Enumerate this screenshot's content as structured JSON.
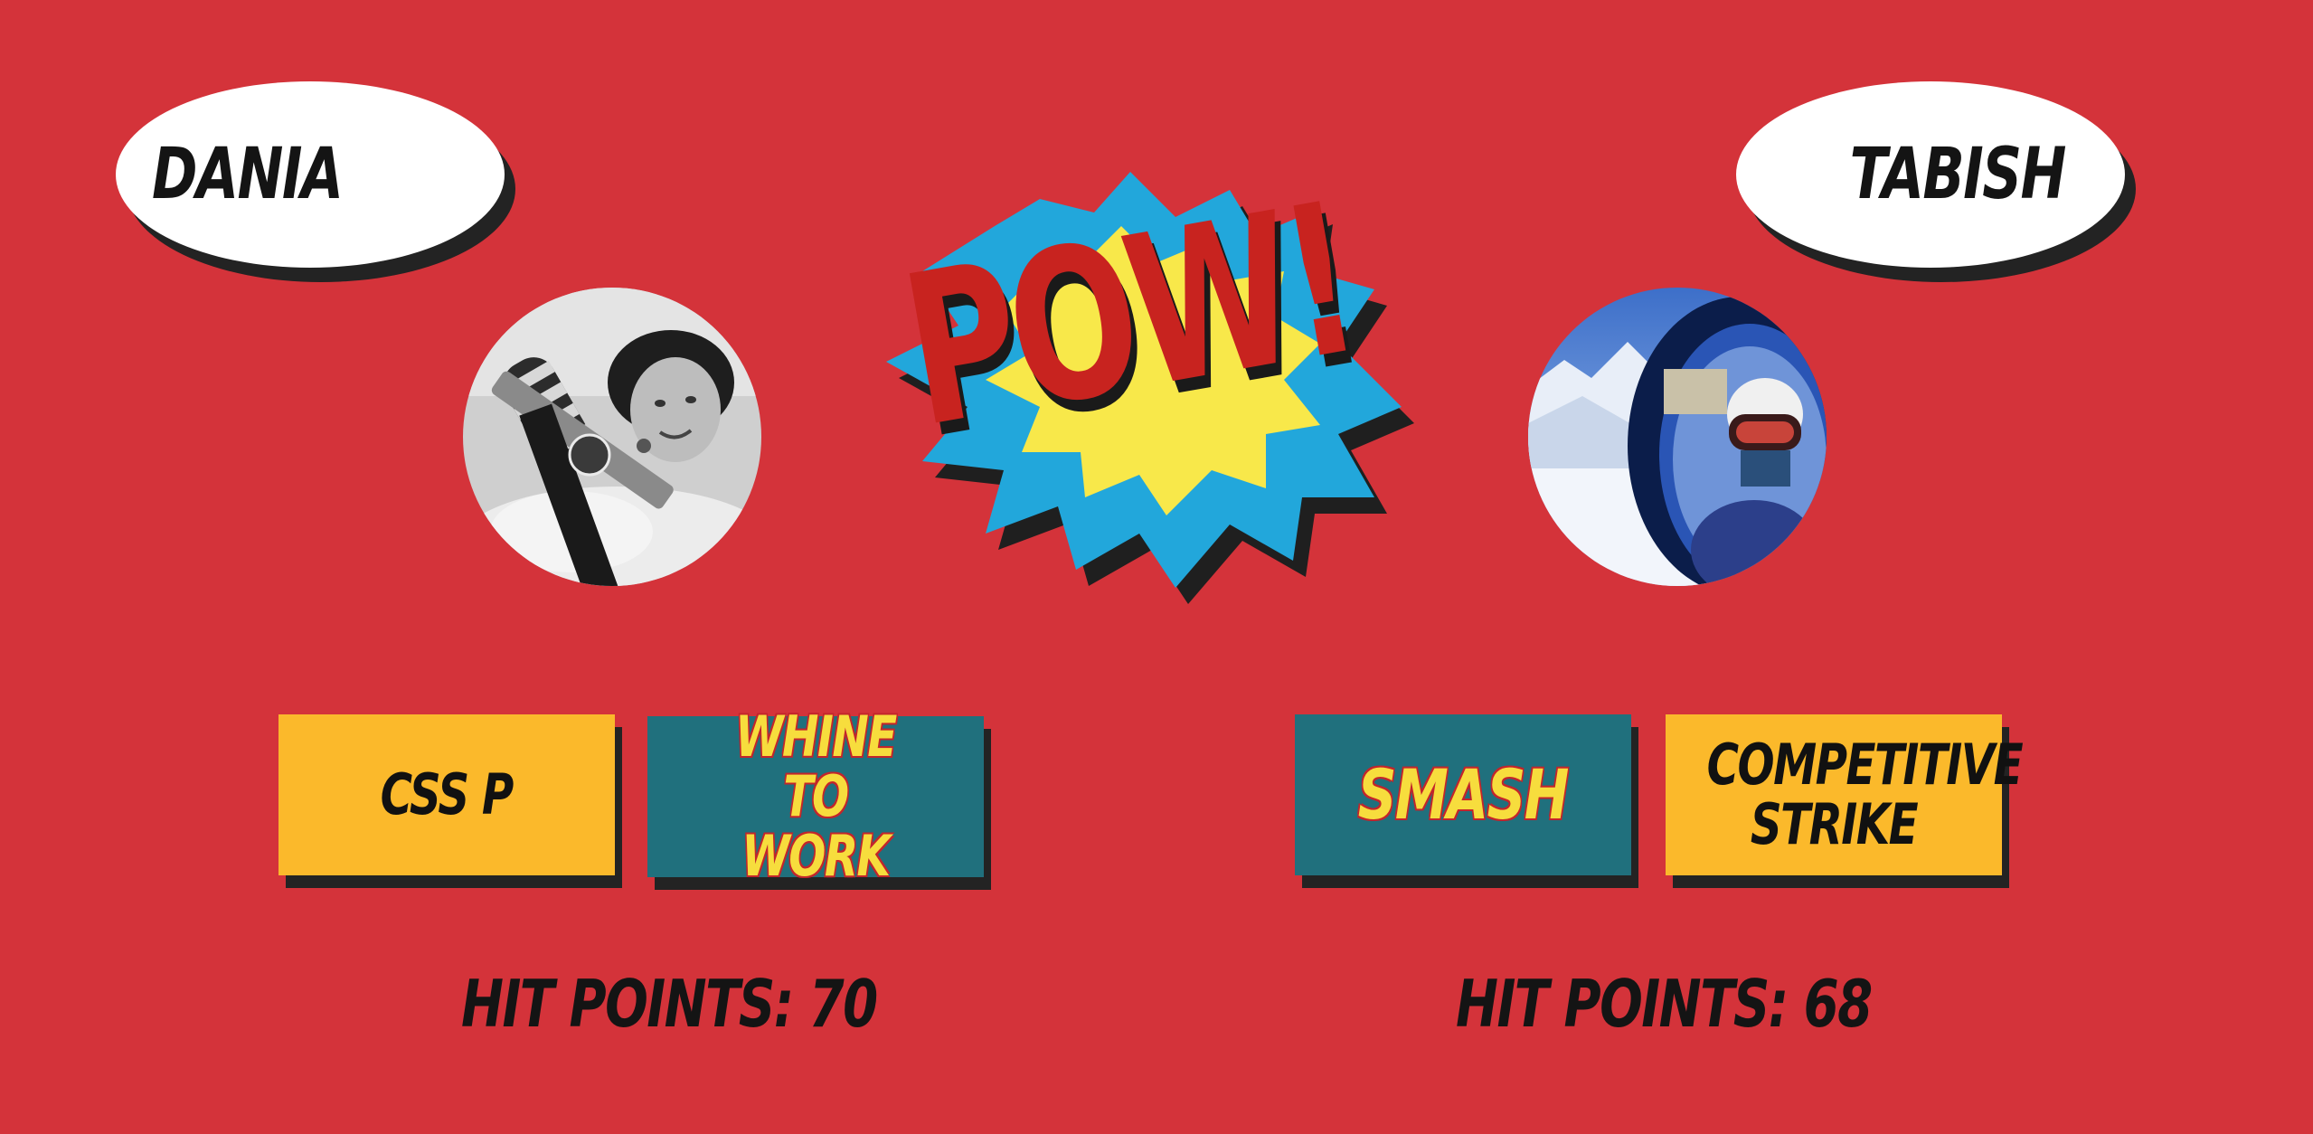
{
  "players": {
    "left": {
      "name": "DANIA",
      "moves": [
        "CSS P",
        "WHINE TO WORK"
      ],
      "hit_points_label": "HIT POINTS:",
      "hit_points": 70
    },
    "right": {
      "name": "TABISH",
      "moves": [
        "SMASH",
        "COMPETITIVE STRIKE"
      ],
      "hit_points_label": "HIT POINTS:",
      "hit_points": 68
    }
  },
  "pow": {
    "text": "POW!"
  },
  "colors": {
    "background": "#d4333a",
    "move_yellow": "#fbb92b",
    "move_teal": "#20707d",
    "pow_blue": "#22a7db",
    "pow_yellow": "#f8e84a",
    "pow_red": "#c8231f"
  },
  "icons": {
    "left_avatar": "player-photo-dania",
    "right_avatar": "player-photo-tabish",
    "burst": "comic-burst-icon"
  }
}
